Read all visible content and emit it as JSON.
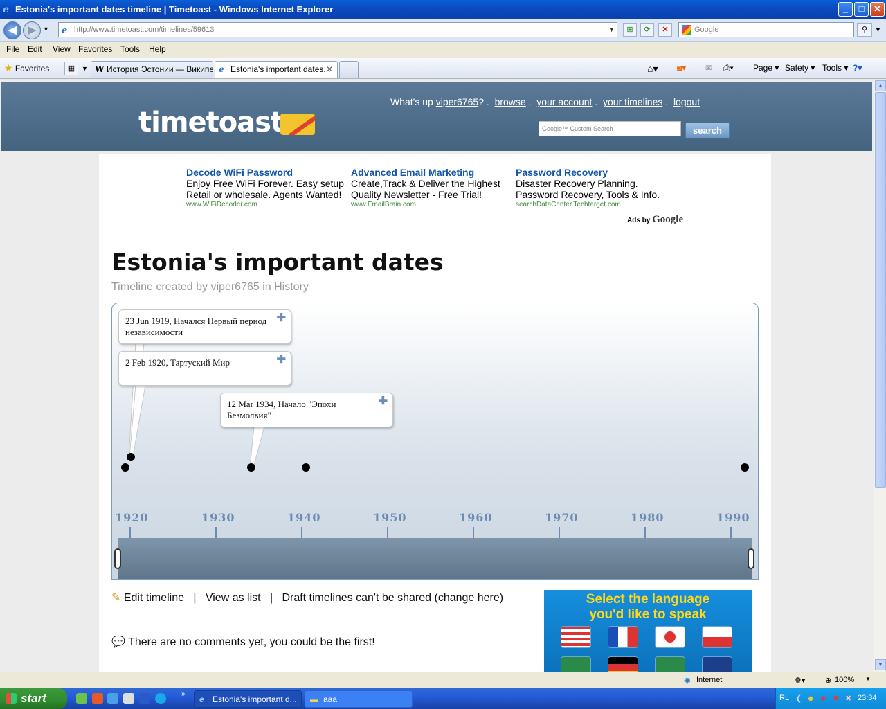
{
  "window": {
    "title": "Estonia's important dates timeline | Timetoast - Windows Internet Explorer",
    "min": "_",
    "max": "□",
    "close": "✕"
  },
  "address": {
    "url": "http://www.timetoast.com/timelines/59613",
    "search_placeholder": "Google"
  },
  "menu": [
    "File",
    "Edit",
    "View",
    "Favorites",
    "Tools",
    "Help"
  ],
  "favorites_label": "Favorites",
  "tabs": [
    {
      "label": "История Эстонии — Википе..."
    },
    {
      "label": "Estonia's important dates..."
    }
  ],
  "commandbar": [
    "Page",
    "Safety",
    "Tools"
  ],
  "site": {
    "logo": "timetoast",
    "nav": {
      "greeting": "What's up",
      "user": "viper6765",
      "q": "?",
      "browse": "browse",
      "account": "your account",
      "timelines": "your timelines",
      "logout": "logout"
    },
    "search_placeholder": "Google™ Custom Search",
    "search_button": "search"
  },
  "ads": [
    {
      "title": "Decode WiFi Password",
      "text": "Enjoy Free WiFi Forever. Easy setup Retail or wholesale. Agents Wanted!",
      "url": "www.WiFiDecoder.com"
    },
    {
      "title": "Advanced Email Marketing",
      "text": "Create,Track & Deliver the Highest Quality Newsletter - Free Trial!",
      "url": "www.EmailBrain.com"
    },
    {
      "title": "Password Recovery",
      "text": "Disaster Recovery Planning. Password Recovery, Tools & Info.",
      "url": "searchDataCenter.Techtarget.com"
    }
  ],
  "ads_by": "Ads by",
  "ads_by_brand": "Google",
  "page": {
    "title": "Estonia's important dates",
    "created_by": "Timeline created by",
    "author": "viper6765",
    "in": "in",
    "category": "History"
  },
  "timeline": {
    "events": [
      {
        "text": "23 Jun 1919,  Начался Первый период независимости"
      },
      {
        "text": "2 Feb 1920, Тартуский Мир"
      },
      {
        "text": "12 Mar 1934, Начало \"Эпохи Безмолвия\""
      }
    ],
    "years": [
      "1920",
      "1930",
      "1940",
      "1950",
      "1960",
      "1970",
      "1980",
      "1990"
    ]
  },
  "actions": {
    "edit": "Edit timeline",
    "sep": "|",
    "list": "View as list",
    "draft": "Draft timelines can't be shared (",
    "change": "change here",
    "close_paren": ")",
    "comments": "There are no comments yet, you could be the first!"
  },
  "language_ad": {
    "line1": "Select the language",
    "line2": "you'd like to speak"
  },
  "status": {
    "zone": "Internet",
    "zoom": "100%"
  },
  "taskbar": {
    "start": "start",
    "tasks": [
      {
        "label": "Estonia's important d..."
      },
      {
        "label": "aaa"
      }
    ],
    "lang": "RL",
    "time": "23:34"
  }
}
